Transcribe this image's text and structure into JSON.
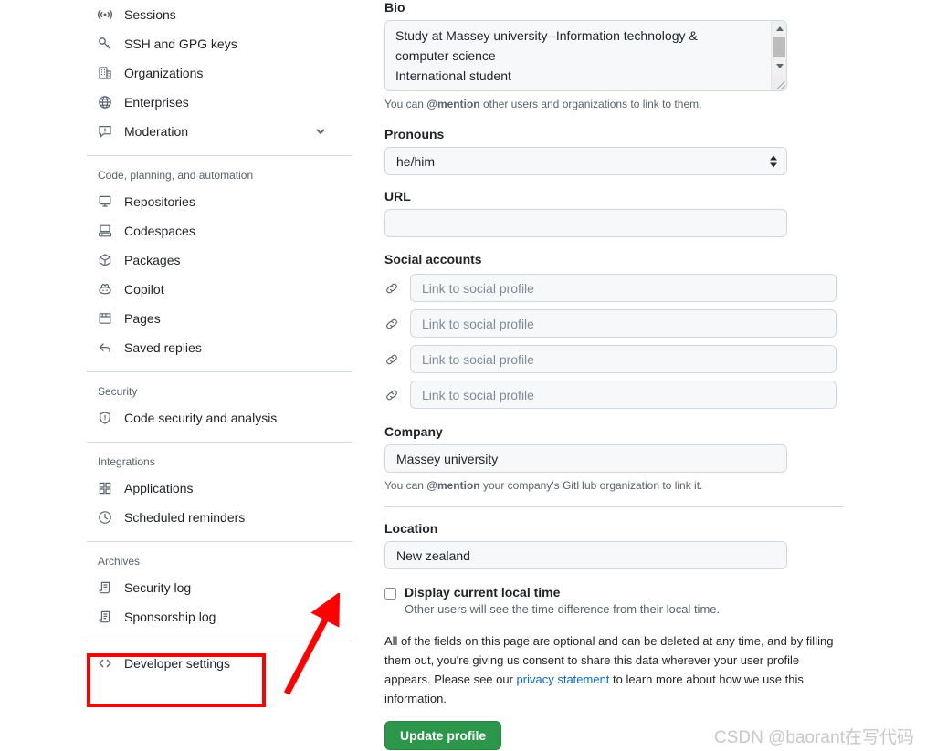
{
  "sidebar": {
    "groups": [
      {
        "title": null,
        "items": [
          {
            "label": "Sessions",
            "icon": "broadcast-icon",
            "expandable": false
          },
          {
            "label": "SSH and GPG keys",
            "icon": "key-icon",
            "expandable": false
          },
          {
            "label": "Organizations",
            "icon": "organization-icon",
            "expandable": false
          },
          {
            "label": "Enterprises",
            "icon": "globe-icon",
            "expandable": false
          },
          {
            "label": "Moderation",
            "icon": "report-icon",
            "expandable": true
          }
        ]
      },
      {
        "title": "Code, planning, and automation",
        "items": [
          {
            "label": "Repositories",
            "icon": "repo-icon",
            "expandable": false
          },
          {
            "label": "Codespaces",
            "icon": "codespaces-icon",
            "expandable": false
          },
          {
            "label": "Packages",
            "icon": "package-icon",
            "expandable": false
          },
          {
            "label": "Copilot",
            "icon": "copilot-icon",
            "expandable": false
          },
          {
            "label": "Pages",
            "icon": "browser-icon",
            "expandable": false
          },
          {
            "label": "Saved replies",
            "icon": "reply-icon",
            "expandable": false
          }
        ]
      },
      {
        "title": "Security",
        "items": [
          {
            "label": "Code security and analysis",
            "icon": "shield-check-icon",
            "expandable": false
          }
        ]
      },
      {
        "title": "Integrations",
        "items": [
          {
            "label": "Applications",
            "icon": "apps-icon",
            "expandable": false
          },
          {
            "label": "Scheduled reminders",
            "icon": "clock-icon",
            "expandable": false
          }
        ]
      },
      {
        "title": "Archives",
        "items": [
          {
            "label": "Security log",
            "icon": "log-icon",
            "expandable": false
          },
          {
            "label": "Sponsorship log",
            "icon": "log-icon",
            "expandable": false
          }
        ]
      },
      {
        "title": null,
        "items": [
          {
            "label": "Developer settings",
            "icon": "code-icon",
            "expandable": false
          }
        ]
      }
    ]
  },
  "profile_form": {
    "bio": {
      "label": "Bio",
      "value": "Study at Massey university--Information technology & computer science\nInternational student",
      "help_prefix": "You can ",
      "help_bold": "@mention",
      "help_suffix": " other users and organizations to link to them."
    },
    "pronouns": {
      "label": "Pronouns",
      "value": "he/him"
    },
    "url": {
      "label": "URL",
      "value": "",
      "placeholder": ""
    },
    "social_accounts": {
      "label": "Social accounts",
      "fields": [
        {
          "value": "",
          "placeholder": "Link to social profile"
        },
        {
          "value": "",
          "placeholder": "Link to social profile"
        },
        {
          "value": "",
          "placeholder": "Link to social profile"
        },
        {
          "value": "",
          "placeholder": "Link to social profile"
        }
      ]
    },
    "company": {
      "label": "Company",
      "value": "Massey university",
      "help_prefix": "You can ",
      "help_bold": "@mention",
      "help_suffix": " your company's GitHub organization to link it."
    },
    "location": {
      "label": "Location",
      "value": "New zealand"
    },
    "local_time": {
      "label": "Display current local time",
      "checked": false,
      "description": "Other users will see the time difference from their local time."
    },
    "legal": {
      "part1": "All of the fields on this page are optional and can be deleted at any time, and by filling them out, you're giving us consent to share this data wherever your user profile appears. Please see our ",
      "link": "privacy statement",
      "part2": " to learn more about how we use this information."
    },
    "submit_label": "Update profile"
  },
  "annotations": {
    "highlight_color": "#ff0000",
    "highlighted_item": "Developer settings"
  },
  "watermark": "CSDN @baorant在写代码"
}
